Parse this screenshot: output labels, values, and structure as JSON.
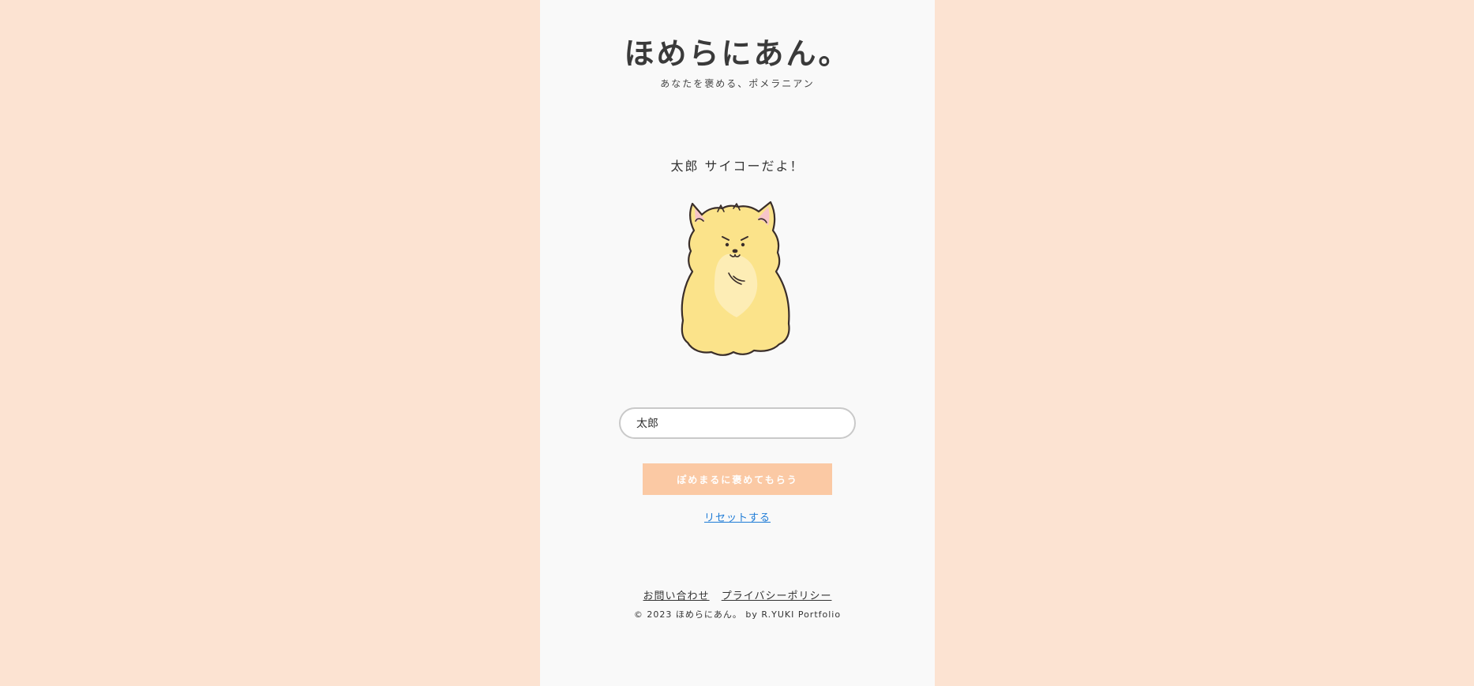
{
  "header": {
    "title": "ほめらにあん。",
    "subtitle": "あなたを褒める、ポメラニアン"
  },
  "main": {
    "praise_message": "太郎 サイコーだよ！",
    "mascot_icon": "pomeranian-dog-illustration",
    "name_input": {
      "value": "太郎",
      "placeholder": ""
    },
    "praise_button_label": "ぽめまるに褒めてもらう",
    "reset_link_label": "リセットする"
  },
  "footer": {
    "links": [
      {
        "label": "お問い合わせ"
      },
      {
        "label": "プライバシーポリシー"
      }
    ],
    "copyright": "© 2023 ほめらにあん。 by R.YUKI Portfolio"
  },
  "colors": {
    "background": "#fce3d2",
    "panel": "#f9f9f9",
    "button": "#fbc9a4",
    "link": "#1e7bd6",
    "dog_fur": "#fbe38a",
    "dog_chest": "#fdedb5",
    "dog_ear_inner": "#f7c5c9"
  }
}
